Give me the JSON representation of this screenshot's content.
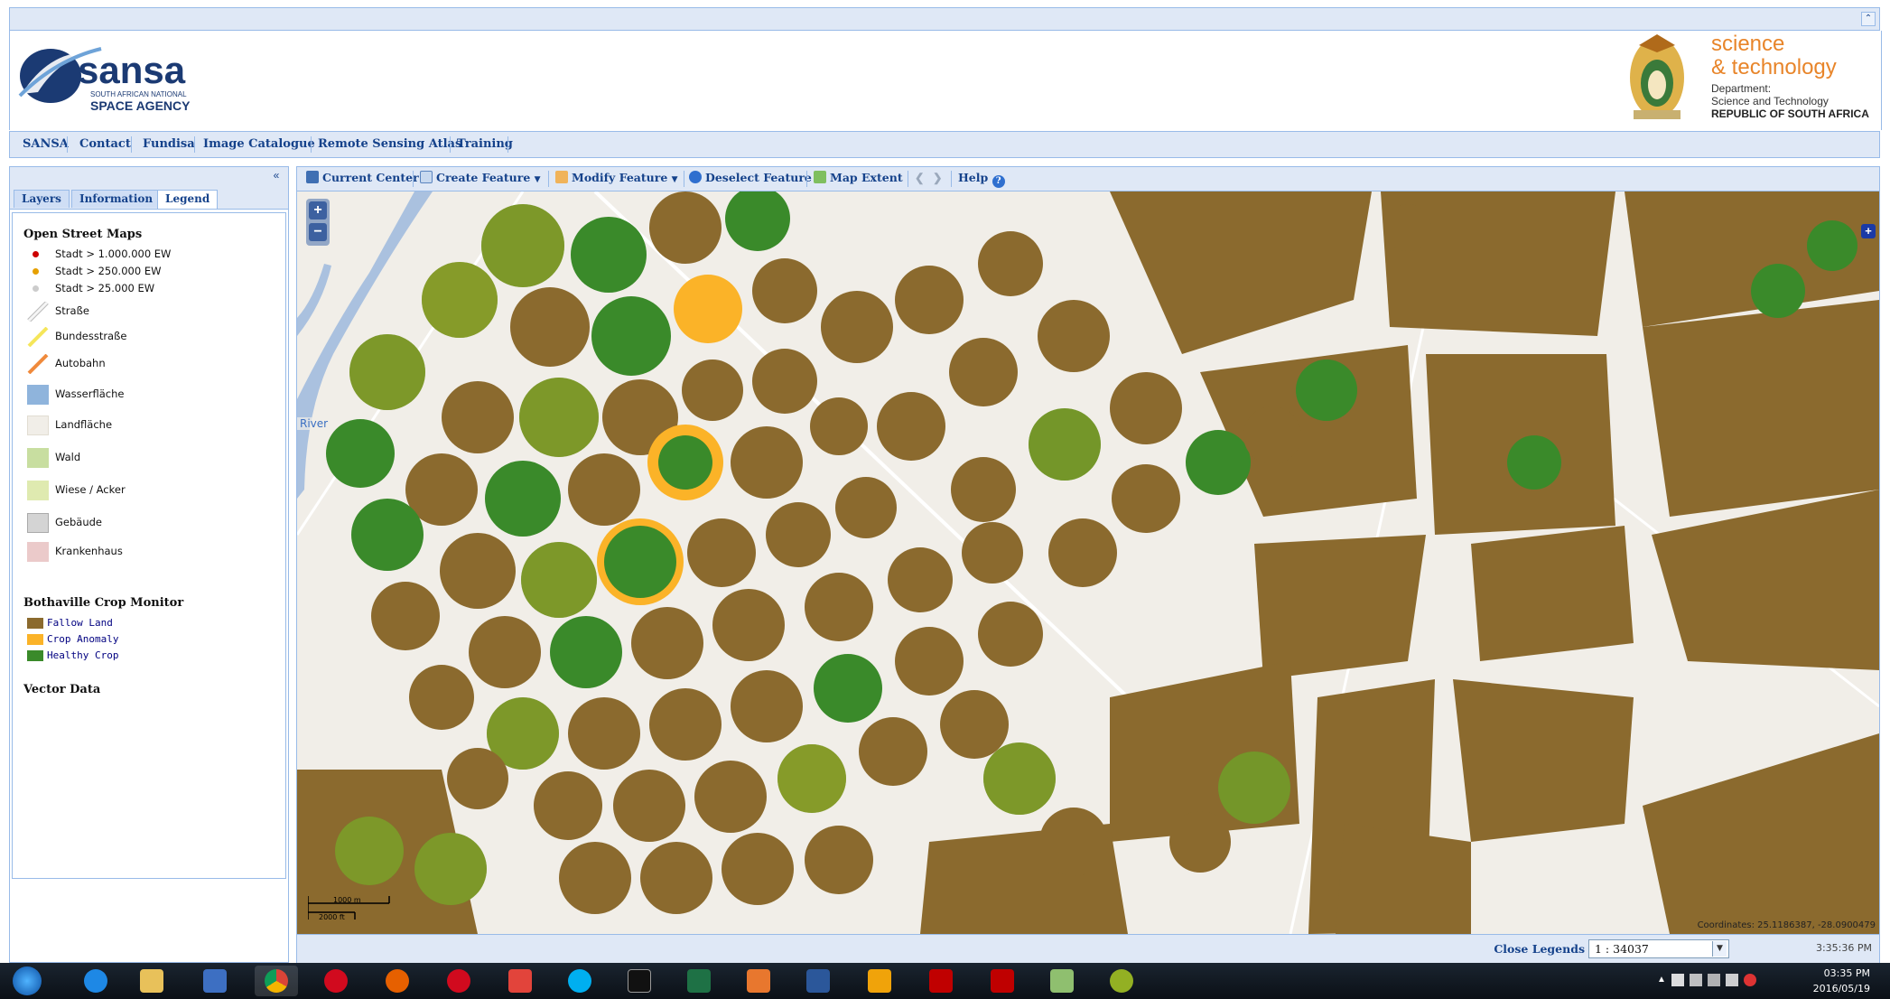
{
  "header": {
    "sansa_logo_text": "sansa",
    "sansa_logo_sub1": "SOUTH AFRICAN NATIONAL",
    "sansa_logo_sub2": "SPACE AGENCY",
    "dst_line1": "science",
    "dst_line2": "& technology",
    "dst_dept1": "Department:",
    "dst_dept2": "Science and Technology",
    "dst_dept3": "REPUBLIC OF SOUTH AFRICA"
  },
  "nav": [
    "SANSA",
    "Contact",
    "Fundisa",
    "Image Catalogue",
    "Remote Sensing Atlas",
    "Training"
  ],
  "tabs": [
    "Layers",
    "Information",
    "Legend"
  ],
  "legend": {
    "osm_title": "Open Street Maps",
    "osm_items": [
      {
        "label": "Stadt > 1.000.000 EW",
        "color": "#cc0000"
      },
      {
        "label": "Stadt > 250.000 EW",
        "color": "#e6a000"
      },
      {
        "label": "Stadt > 25.000 EW",
        "color": "#cccccc"
      },
      {
        "label": "Straße",
        "color": "#dddddd"
      },
      {
        "label": "Bundesstraße",
        "color": "#f5e65a"
      },
      {
        "label": "Autobahn",
        "color": "#f08a3c"
      },
      {
        "label": "Wasserfläche",
        "color": "#8fb4dc"
      },
      {
        "label": "Landfläche",
        "color": "#f1eee8"
      },
      {
        "label": "Wald",
        "color": "#c8dea0"
      },
      {
        "label": "Wiese / Acker",
        "color": "#dfeab0"
      },
      {
        "label": "Gebäude",
        "color": "#d4d4d4"
      },
      {
        "label": "Krankenhaus",
        "color": "#ebcaca"
      }
    ],
    "crop_title": "Bothaville Crop Monitor",
    "crop_items": [
      {
        "label": "Fallow Land",
        "color": "#8b6a2e"
      },
      {
        "label": "Crop Anomaly",
        "color": "#fbb328"
      },
      {
        "label": "Healthy Crop",
        "color": "#3a8a2a"
      }
    ],
    "vector_title": "Vector Data"
  },
  "toolbar": {
    "current_center": "Current Center",
    "create_feature": "Create Feature",
    "modify_feature": "Modify Feature",
    "deselect_feature": "Deselect Feature",
    "map_extent": "Map Extent",
    "help": "Help"
  },
  "map": {
    "river_label": "River",
    "scale_m": "1000 m",
    "scale_ft": "2000 ft",
    "coordinates": "Coordinates: 25.1186387, -28.0900479",
    "colors": {
      "fallow": "#8b6a2e",
      "anomaly": "#fbb328",
      "healthy": "#3a8a2a",
      "land": "#f1eee8",
      "water": "#aac1df"
    }
  },
  "status": {
    "close_legends": "Close Legends",
    "scale_value": "1 : 34037",
    "time": "3:35:36 PM"
  },
  "taskbar": {
    "apps": [
      "start-button",
      "internet-explorer-icon",
      "file-explorer-icon",
      "media-player-icon",
      "chrome-icon",
      "opera-icon",
      "firefox-icon",
      "opera-icon",
      "acrobat-icon",
      "skype-icon",
      "command-prompt-icon",
      "excel-icon",
      "matlab-icon",
      "word-icon",
      "outlook-icon",
      "envi-icon",
      "filezilla-icon",
      "notepad-icon",
      "qgis-icon"
    ],
    "clock_time": "03:35 PM",
    "clock_date": "2016/05/19"
  }
}
